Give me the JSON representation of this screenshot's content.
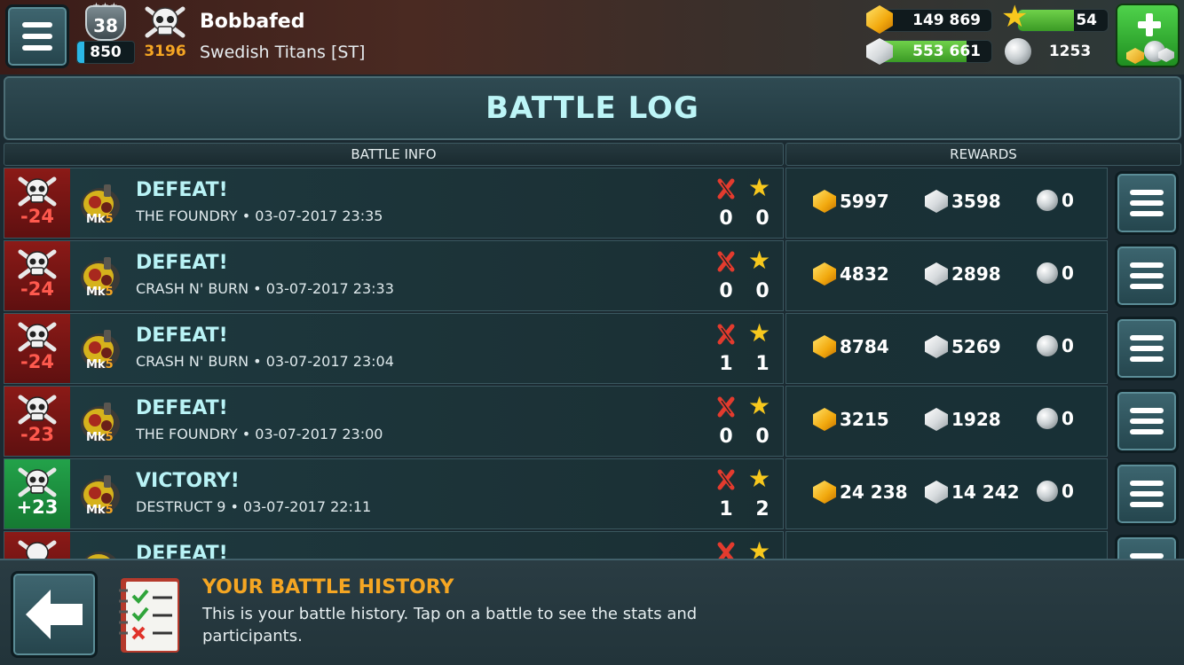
{
  "player": {
    "level": "38",
    "xp": "850",
    "trophies": "3196",
    "name": "Bobbafed",
    "clan": "Swedish Titans [ST]"
  },
  "resources": {
    "gold": "149 869",
    "silver": "553 661",
    "stars": "54",
    "pearls": "1253",
    "silver_fill_fraction": 0.78,
    "stars_fill_fraction": 0.62
  },
  "header": {
    "title": "BATTLE LOG",
    "col_battle_info": "BATTLE INFO",
    "col_rewards": "REWARDS"
  },
  "colors": {
    "title": "#bdf5f7",
    "defeat": "#8b1a17",
    "victory": "#23a24a",
    "gold_text": "#f5a623"
  },
  "battles": [
    {
      "trophy_delta": "-24",
      "robot_mk": "Mk",
      "robot_level": "5",
      "result": "DEFEAT!",
      "map": "THE FOUNDRY",
      "datetime": "03-07-2017 23:35",
      "kills": "0",
      "stars": "0",
      "gold": "5997",
      "silver": "3598",
      "pearls": "0"
    },
    {
      "trophy_delta": "-24",
      "robot_mk": "Mk",
      "robot_level": "5",
      "result": "DEFEAT!",
      "map": "CRASH N' BURN",
      "datetime": "03-07-2017 23:33",
      "kills": "0",
      "stars": "0",
      "gold": "4832",
      "silver": "2898",
      "pearls": "0"
    },
    {
      "trophy_delta": "-24",
      "robot_mk": "Mk",
      "robot_level": "5",
      "result": "DEFEAT!",
      "map": "CRASH N' BURN",
      "datetime": "03-07-2017 23:04",
      "kills": "1",
      "stars": "1",
      "gold": "8784",
      "silver": "5269",
      "pearls": "0"
    },
    {
      "trophy_delta": "-23",
      "robot_mk": "Mk",
      "robot_level": "5",
      "result": "DEFEAT!",
      "map": "THE FOUNDRY",
      "datetime": "03-07-2017 23:00",
      "kills": "0",
      "stars": "0",
      "gold": "3215",
      "silver": "1928",
      "pearls": "0"
    },
    {
      "trophy_delta": "+23",
      "robot_mk": "Mk",
      "robot_level": "5",
      "result": "VICTORY!",
      "map": "DESTRUCT 9",
      "datetime": "03-07-2017 22:11",
      "kills": "1",
      "stars": "2",
      "gold": "24 238",
      "silver": "14 242",
      "pearls": "0"
    },
    {
      "result": "DEFEAT!"
    }
  ],
  "help": {
    "title": "YOUR BATTLE HISTORY",
    "text": "This is your battle history. Tap on a battle to see the stats and participants."
  }
}
